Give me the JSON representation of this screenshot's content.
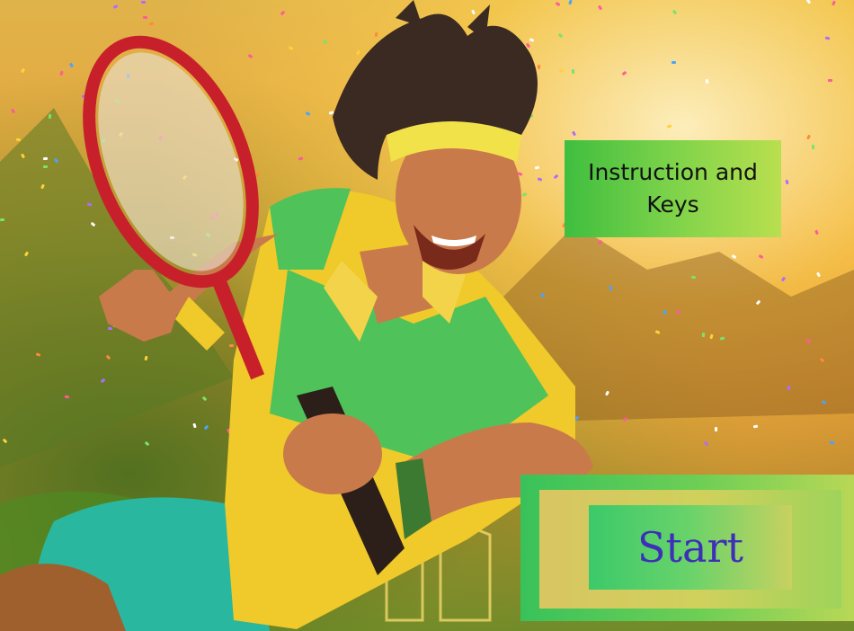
{
  "menu": {
    "instruction_label": "Instruction and Keys",
    "start_label": "Start"
  },
  "scene": {
    "character": "tennis-player",
    "colors": {
      "headband": "#f2e24a",
      "shirt_yellow": "#f0c92a",
      "shirt_green": "#4fc25a",
      "shorts": "#2ab7a0",
      "racket": "#c8202a",
      "start_text": "#3e2fb8"
    }
  }
}
